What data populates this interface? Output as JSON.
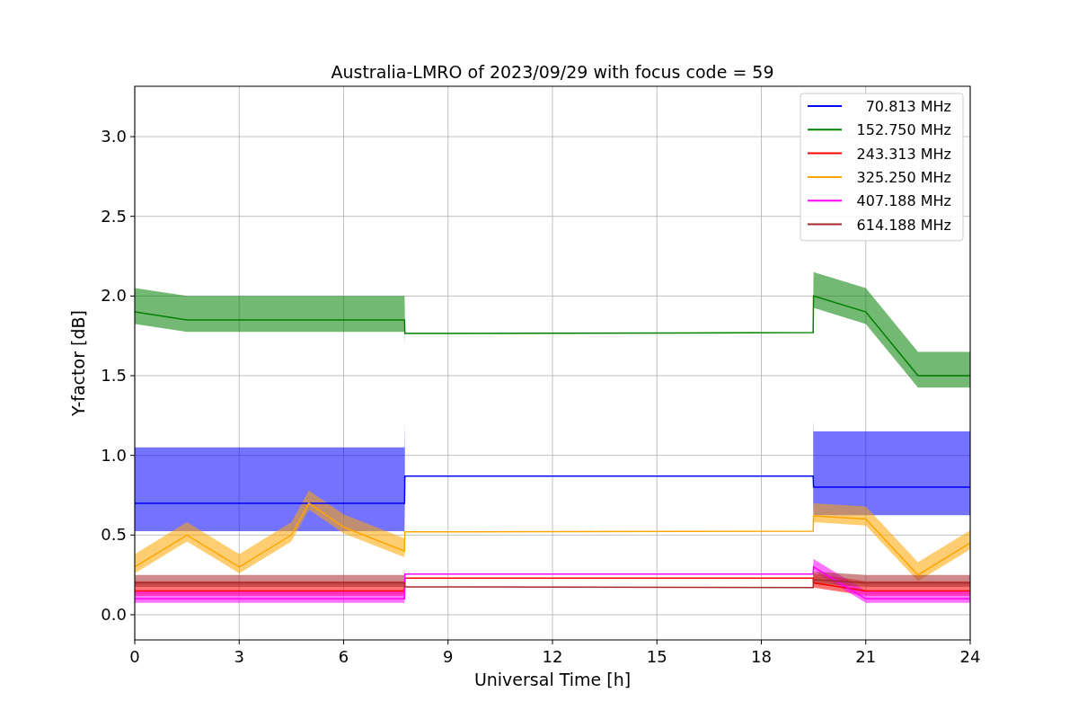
{
  "figure": {
    "chart_data": {
      "type": "line",
      "title": "Australia-LMRO of 2023/09/29 with focus code = 59",
      "xlabel": "Universal Time [h]",
      "ylabel": "Y-factor [dB]",
      "x": [
        0,
        1.5,
        3,
        4.5,
        5,
        6,
        7.75,
        7.76,
        19.49,
        19.5,
        21,
        22.5,
        24
      ],
      "grid": true,
      "legend": true,
      "xlim": [
        0,
        24
      ],
      "ylim": [
        -0.158,
        3.316
      ],
      "xticks": [
        0,
        3,
        6,
        9,
        12,
        15,
        18,
        21,
        24
      ],
      "yticks": [
        {
          "value": 0,
          "label": "0.0"
        },
        {
          "value": 0.5,
          "label": "0.5"
        },
        {
          "value": 1,
          "label": "1.0"
        },
        {
          "value": 1.5,
          "label": "1.5"
        },
        {
          "value": 2,
          "label": "2.0"
        },
        {
          "value": 2.5,
          "label": "2.5"
        },
        {
          "value": 3,
          "label": "3.0"
        }
      ],
      "series": [
        {
          "name": "70.813 MHz",
          "color": "#0000ff",
          "values": [
            0.7,
            0.7,
            0.7,
            0.7,
            0.7,
            0.7,
            0.7,
            0.87,
            0.87,
            0.8,
            0.8,
            0.8,
            0.8
          ]
        },
        {
          "name": "152.750 MHz",
          "color": "#008000",
          "values": [
            1.9,
            1.85,
            1.85,
            1.85,
            1.85,
            1.85,
            1.85,
            1.765,
            1.77,
            2.0,
            1.9,
            1.5,
            1.5
          ]
        },
        {
          "name": "243.313 MHz",
          "color": "#ff0000",
          "values": [
            0.15,
            0.15,
            0.15,
            0.15,
            0.15,
            0.15,
            0.15,
            0.23,
            0.23,
            0.2,
            0.15,
            0.15,
            0.15
          ]
        },
        {
          "name": "325.250 MHz",
          "color": "#ffa500",
          "values": [
            0.3,
            0.5,
            0.3,
            0.5,
            0.7,
            0.55,
            0.4,
            0.52,
            0.525,
            0.62,
            0.6,
            0.25,
            0.45
          ]
        },
        {
          "name": "407.188 MHz",
          "color": "#ff00ff",
          "values": [
            0.1,
            0.1,
            0.1,
            0.1,
            0.1,
            0.1,
            0.1,
            0.255,
            0.255,
            0.3,
            0.1,
            0.1,
            0.1
          ]
        },
        {
          "name": "614.188 MHz",
          "color": "#a52a2a",
          "values": [
            0.2,
            0.2,
            0.2,
            0.2,
            0.2,
            0.2,
            0.2,
            0.175,
            0.17,
            0.22,
            0.2,
            0.2,
            0.2
          ]
        }
      ]
    }
  }
}
